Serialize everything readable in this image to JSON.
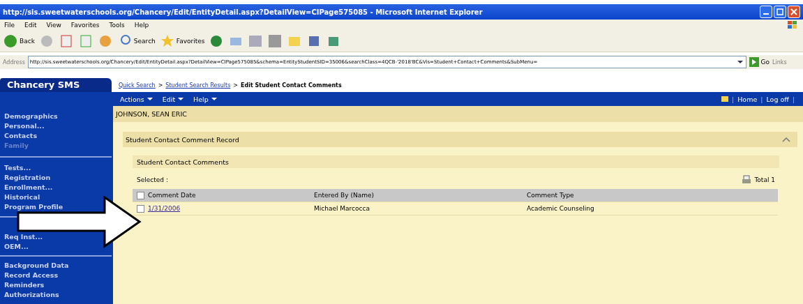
{
  "window": {
    "title": "http://sis.sweetwaterschools.org/Chancery/Edit/EntityDetail.aspx?DetailView=CIPage575085 - Microsoft Internet Explorer"
  },
  "menu_bar": [
    "File",
    "Edit",
    "View",
    "Favorites",
    "Tools",
    "Help"
  ],
  "toolbar": [
    {
      "kind": "back",
      "label": "Back"
    },
    {
      "kind": "forward"
    },
    {
      "kind": "stop"
    },
    {
      "kind": "refresh"
    },
    {
      "kind": "home"
    },
    {
      "kind": "search",
      "label": "Search"
    },
    {
      "kind": "favorites",
      "label": "Favorites"
    },
    {
      "kind": "media"
    },
    {
      "kind": "mail"
    },
    {
      "kind": "print"
    },
    {
      "kind": "edit"
    },
    {
      "kind": "folder"
    },
    {
      "kind": "messenger"
    },
    {
      "kind": "tool"
    }
  ],
  "address_bar": {
    "label": "Address",
    "value": "http://sis.sweetwaterschools.org/Chancery/Edit/EntityDetail.aspx?DetailView=CIPage575085&schema=EntityStudentSID=35006&searchClass=4QCB-'2018'BC&Vis=Student+Contact+Comments&SubMenu=",
    "go": "Go",
    "links": "Links"
  },
  "app": {
    "logo": "Chancery SMS",
    "breadcrumb": [
      {
        "label": "Quick Search",
        "kind": "link"
      },
      {
        "label": ">",
        "kind": "separator"
      },
      {
        "label": "Student Search Results",
        "kind": "link"
      },
      {
        "label": ">",
        "kind": "separator"
      },
      {
        "label": "Edit Student Contact Comments",
        "kind": "current"
      }
    ],
    "nav_menu": [
      "Actions",
      "Edit",
      "Help"
    ],
    "top_links": [
      {
        "label": "|",
        "kind": "separator"
      },
      {
        "label": "Home",
        "kind": "link"
      },
      {
        "label": "|",
        "kind": "separator"
      },
      {
        "label": "Log off",
        "kind": "link"
      },
      {
        "label": "|",
        "kind": "separator"
      }
    ],
    "sidebar": [
      {
        "items": [
          {
            "label": "Demographics",
            "disabled": false
          },
          {
            "label": "Personal...",
            "disabled": false
          },
          {
            "label": "Contacts",
            "disabled": false
          },
          {
            "label": "Family",
            "disabled": true
          }
        ]
      },
      {
        "items": [
          {
            "label": "Tests...",
            "disabled": false
          },
          {
            "label": "Registration",
            "disabled": false
          },
          {
            "label": "Enrollment...",
            "disabled": false
          },
          {
            "label": "Historical",
            "disabled": false
          },
          {
            "label": "Program Profile",
            "disabled": false
          }
        ]
      },
      {
        "items": [
          {
            "label": "Req Inst...",
            "disabled": false
          },
          {
            "label": "OEM...",
            "disabled": false
          }
        ]
      },
      {
        "items": [
          {
            "label": "Background Data",
            "disabled": false
          },
          {
            "label": "Record Access",
            "disabled": false
          },
          {
            "label": "Reminders",
            "disabled": false
          },
          {
            "label": "Authorizations",
            "disabled": false
          }
        ]
      }
    ],
    "student_name": "JOHNSON, SEAN ERIC",
    "record_title": "Student Contact Comment Record",
    "expanded": true,
    "section_title": "Student Contact Comments",
    "selected_label": "Selected :",
    "total": "Total 1",
    "table": {
      "columns": [
        "Comment Date",
        "Entered By (Name)",
        "Comment Type"
      ],
      "header_checked": false,
      "rows": [
        {
          "checked": false,
          "cells": [
            "1/31/2006",
            "Michael Marcocca",
            "Academic Counseling"
          ]
        }
      ]
    }
  }
}
